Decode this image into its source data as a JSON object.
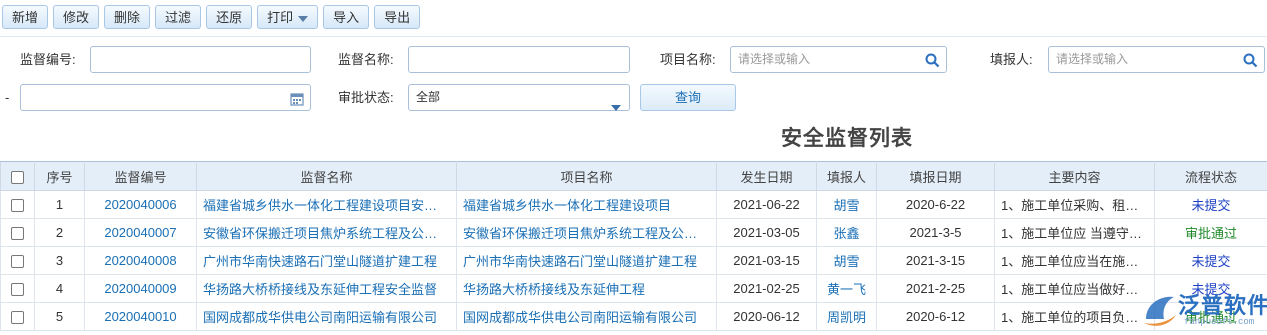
{
  "toolbar": {
    "add": "新增",
    "edit": "修改",
    "delete": "删除",
    "filter": "过滤",
    "restore": "还原",
    "print": "打印",
    "import": "导入",
    "export": "导出"
  },
  "form": {
    "code_label": "监督编号:",
    "name_label": "监督名称:",
    "project_label": "项目名称:",
    "project_placeholder": "请选择或输入",
    "reporter_label": "填报人:",
    "reporter_placeholder": "请选择或输入",
    "dash": "-",
    "status_label": "审批状态:",
    "status_value": "全部",
    "query": "查询"
  },
  "title": "安全监督列表",
  "table": {
    "headers": [
      "序号",
      "监督编号",
      "监督名称",
      "项目名称",
      "发生日期",
      "填报人",
      "填报日期",
      "主要内容",
      "流程状态"
    ],
    "rows": [
      {
        "no": "1",
        "code": "2020040006",
        "name": "福建省城乡供水一体化工程建设项目安全监督",
        "project": "福建省城乡供水一体化工程建设项目",
        "date": "2021-06-22",
        "reporter": "胡雪",
        "report_date": "2020-6-22",
        "content": "1、施工单位采购、租赁的安全防护用具",
        "status": "未提交",
        "status_color": "#1a3fc4"
      },
      {
        "no": "2",
        "code": "2020040007",
        "name": "安徽省环保搬迁项目焦炉系统工程及公辅设施",
        "project": "安徽省环保搬迁项目焦炉系统工程及公辅设施",
        "date": "2021-03-05",
        "reporter": "张鑫",
        "report_date": "2021-3-5",
        "content": "1、施工单位应 当遵守有关环境保护法律",
        "status": "审批通过",
        "status_color": "#1f8a2a"
      },
      {
        "no": "3",
        "code": "2020040008",
        "name": "广州市华南快速路石门堂山隧道扩建工程",
        "project": "广州市华南快速路石门堂山隧道扩建工程",
        "date": "2021-03-15",
        "reporter": "胡雪",
        "report_date": "2021-3-15",
        "content": "1、施工单位应当在施工现场建立消防",
        "status": "未提交",
        "status_color": "#1a3fc4"
      },
      {
        "no": "4",
        "code": "2020040009",
        "name": "华扬路大桥桥接线及东延伸工程安全监督",
        "project": "华扬路大桥桥接线及东延伸工程",
        "date": "2021-02-25",
        "reporter": "黄一飞",
        "report_date": "2021-2-25",
        "content": "1、施工单位应当做好职工",
        "status": "未提交",
        "status_color": "#1a3fc4"
      },
      {
        "no": "5",
        "code": "2020040010",
        "name": "国网成都成华供电公司南阳运输有限公司",
        "project": "国网成都成华供电公司南阳运输有限公司",
        "date": "2020-06-12",
        "reporter": "周凯明",
        "report_date": "2020-6-12",
        "content": "1、施工单位的项目负责人",
        "status": "审批通过",
        "status_color": "#1f8a2a"
      }
    ]
  },
  "logo": {
    "text": "泛普软件",
    "sub": "fanpusoft.com",
    "color": "#2a6fc0"
  },
  "icons": {
    "search": "search-icon",
    "calendar": "calendar-icon",
    "dropdown": "chevron-down-icon"
  }
}
